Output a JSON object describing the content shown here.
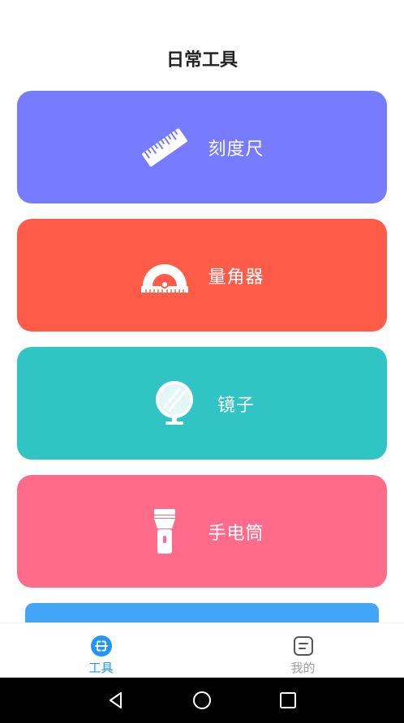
{
  "header": {
    "title": "日常工具"
  },
  "cards": [
    {
      "label": "刻度尺",
      "icon": "ruler-icon",
      "color": "#767BFF"
    },
    {
      "label": "量角器",
      "icon": "protractor-icon",
      "color": "#FF5B49"
    },
    {
      "label": "镜子",
      "icon": "mirror-icon",
      "color": "#31C4C4"
    },
    {
      "label": "手电筒",
      "icon": "flashlight-icon",
      "color": "#FF6B8A"
    }
  ],
  "peek_card": {
    "color": "#42A5F5"
  },
  "bottom_nav": {
    "active_color": "#2196F3",
    "inactive_color": "#9E9E9E",
    "items": [
      {
        "label": "工具",
        "icon": "tools-icon",
        "active": true
      },
      {
        "label": "我的",
        "icon": "profile-icon",
        "active": false
      }
    ]
  },
  "system_nav": {
    "icons": [
      "back-icon",
      "home-icon",
      "recents-icon"
    ]
  }
}
